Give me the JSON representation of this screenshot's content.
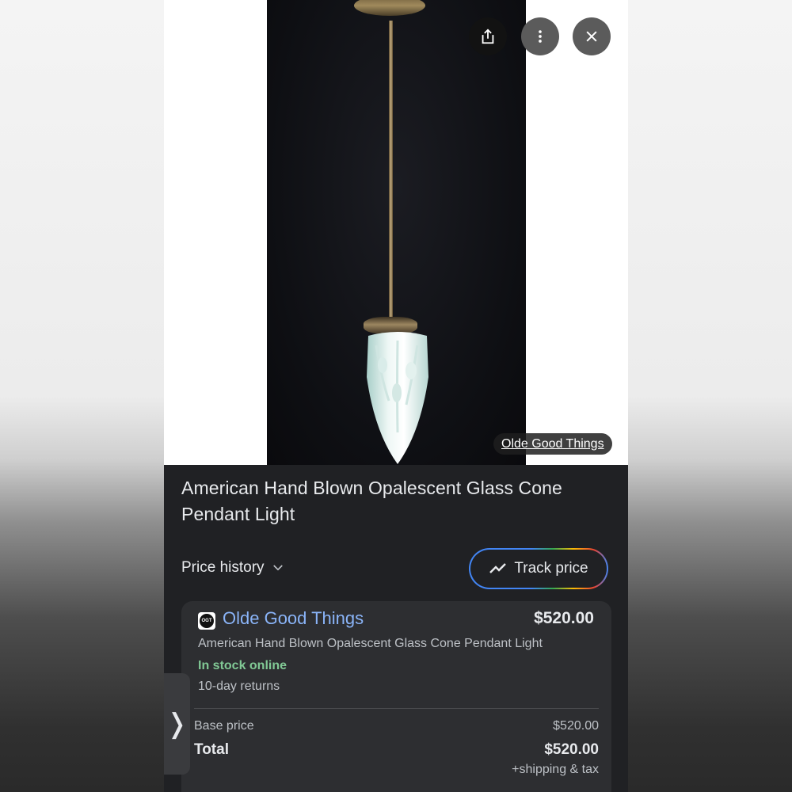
{
  "photo": {
    "source_chip": "Olde Good Things"
  },
  "toolbar": {
    "share_icon": "share-icon",
    "more_icon": "more-vert-icon",
    "close_icon": "close-icon"
  },
  "product": {
    "title": "American Hand Blown Opalescent Glass Cone Pendant Light"
  },
  "price_history": {
    "label": "Price history",
    "icon": "chevron-down-icon"
  },
  "track_price": {
    "label": "Track price",
    "icon": "trend-icon"
  },
  "offer": {
    "store_logo_text": "OGT",
    "store_name": "Olde Good Things",
    "price": "$520.00",
    "description": "American Hand Blown Opalescent Glass Cone Pendant Light",
    "stock_status": "In stock online",
    "returns": "10-day returns",
    "base_price_label": "Base price",
    "base_price_value": "$520.00",
    "total_label": "Total",
    "total_value": "$520.00",
    "shipping_note": "+shipping & tax"
  },
  "side_tab": {
    "glyph": "❭"
  },
  "colors": {
    "link_blue": "#8ab4f8",
    "stock_green": "#81c995",
    "panel_bg": "#202124",
    "card_bg": "#2d2e31"
  }
}
